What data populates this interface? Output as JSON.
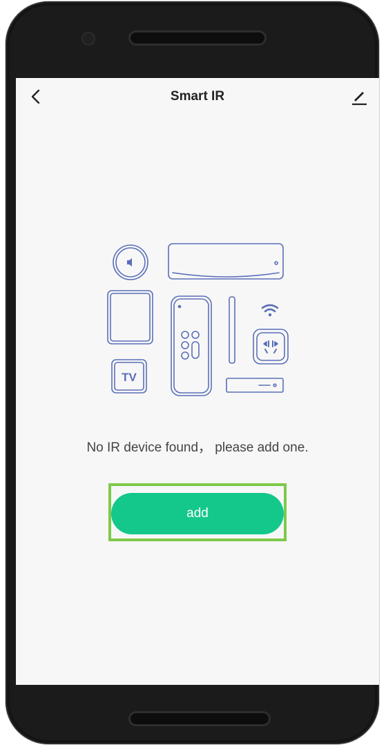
{
  "header": {
    "title": "Smart IR"
  },
  "empty_state": {
    "message": "No IR device found， please add one.",
    "tv_label": "TV"
  },
  "actions": {
    "add_label": "add"
  },
  "icons": {
    "back": "chevron-left-icon",
    "edit": "pencil-icon"
  },
  "colors": {
    "accent": "#14c78b",
    "highlight": "#7dc94a",
    "illustration_stroke": "#5a6fb8"
  }
}
